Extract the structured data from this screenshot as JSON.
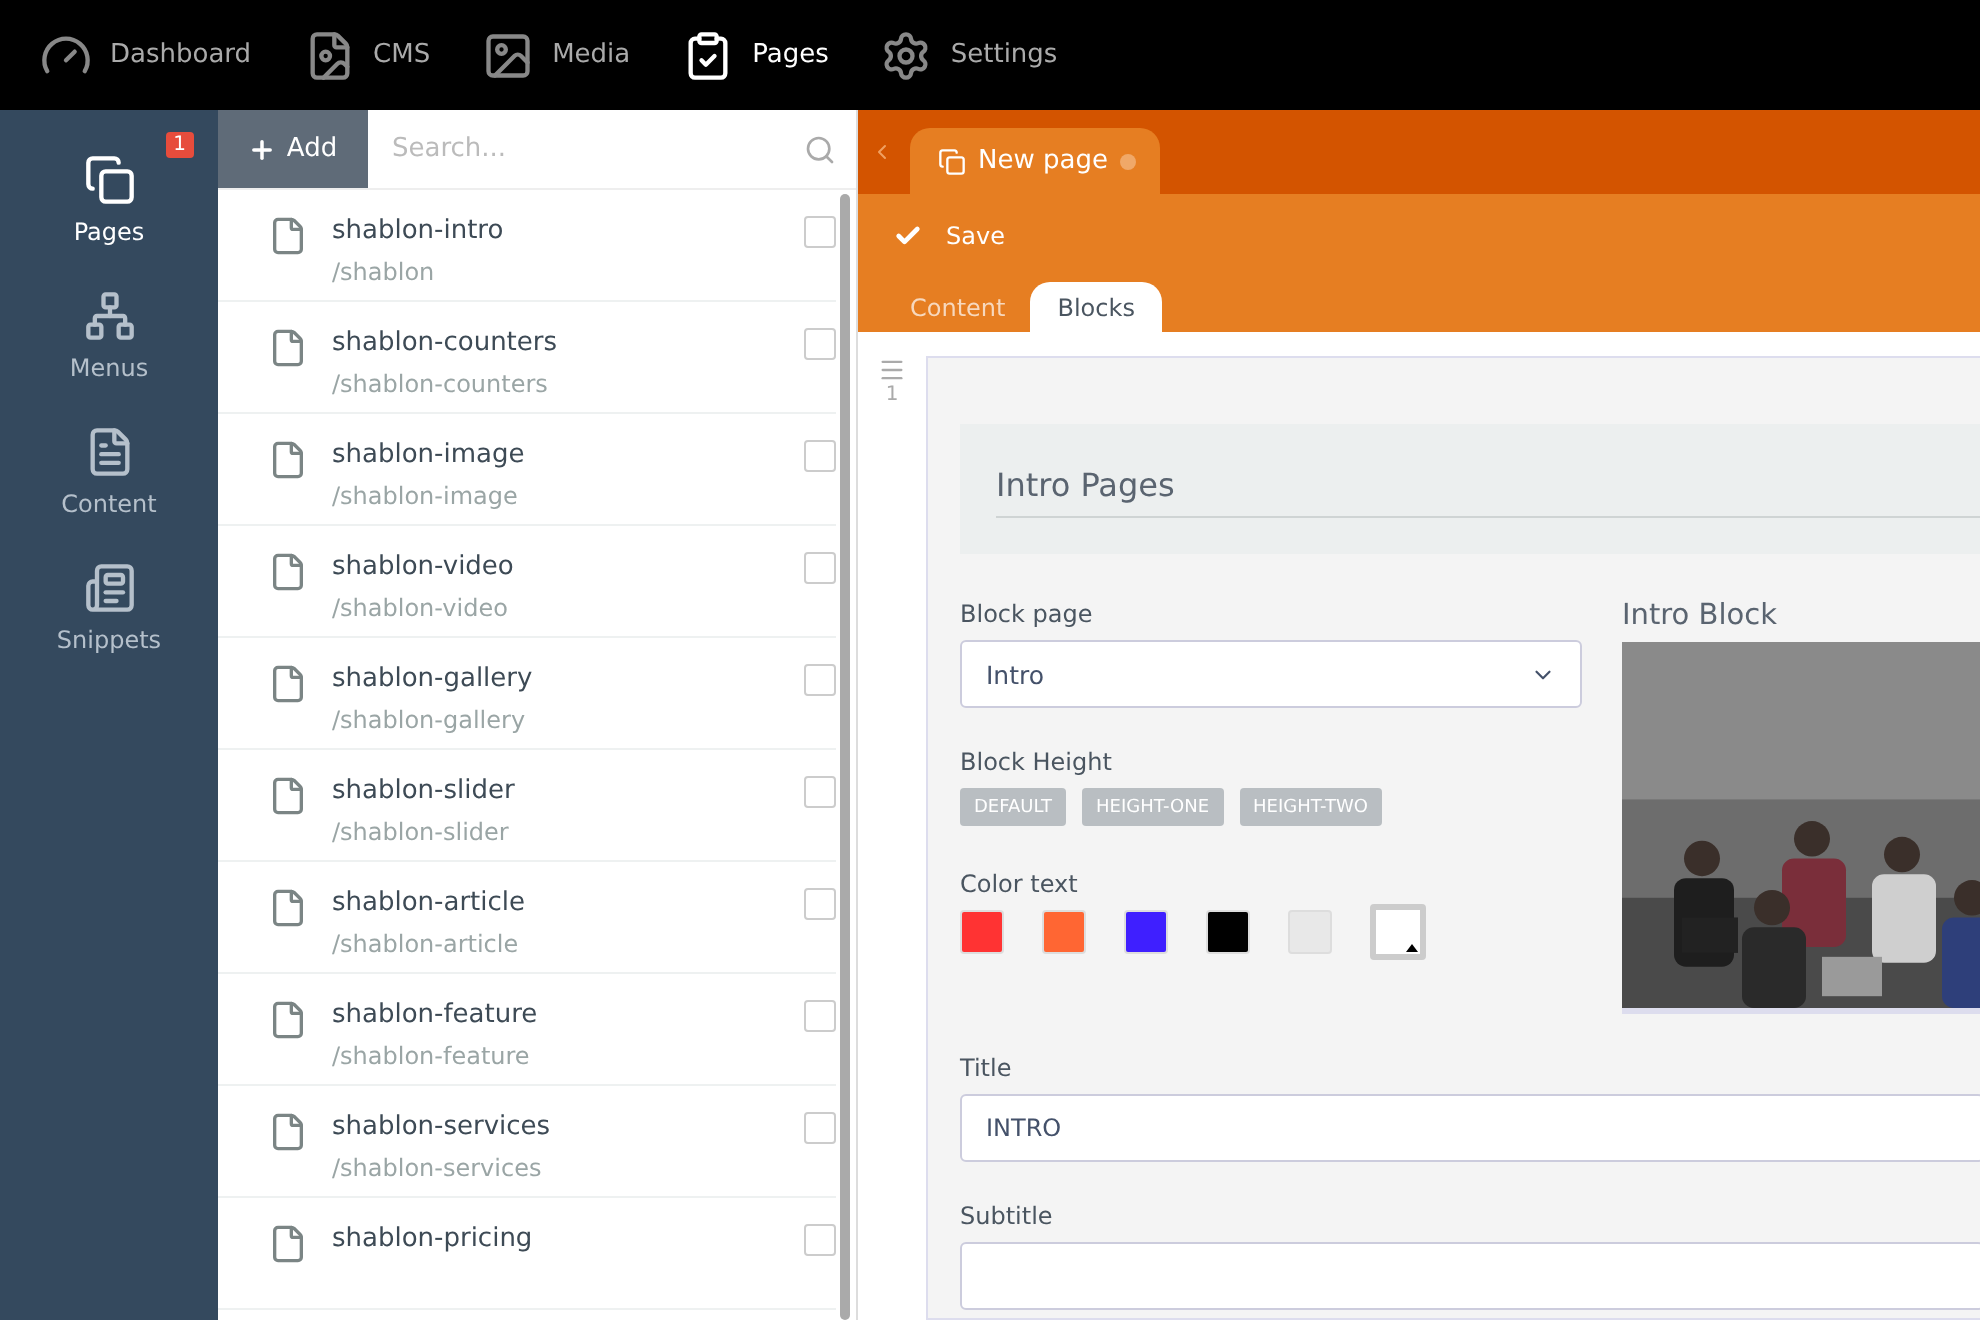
{
  "top_nav": [
    {
      "label": "Dashboard",
      "selected": false
    },
    {
      "label": "CMS",
      "selected": false
    },
    {
      "label": "Media",
      "selected": false
    },
    {
      "label": "Pages",
      "selected": true
    },
    {
      "label": "Settings",
      "selected": false
    }
  ],
  "sidebar": {
    "items": [
      {
        "label": "Pages",
        "selected": true,
        "badge": "1"
      },
      {
        "label": "Menus",
        "selected": false
      },
      {
        "label": "Content",
        "selected": false
      },
      {
        "label": "Snippets",
        "selected": false
      }
    ]
  },
  "page_list": {
    "add_button": "Add",
    "search": {
      "placeholder": "Search..."
    },
    "items": [
      {
        "name": "shablon-intro",
        "path": "/shablon",
        "checked": false
      },
      {
        "name": "shablon-counters",
        "path": "/shablon-counters",
        "checked": false
      },
      {
        "name": "shablon-image",
        "path": "/shablon-image",
        "checked": false
      },
      {
        "name": "shablon-video",
        "path": "/shablon-video",
        "checked": false
      },
      {
        "name": "shablon-gallery",
        "path": "/shablon-gallery",
        "checked": false
      },
      {
        "name": "shablon-slider",
        "path": "/shablon-slider",
        "checked": false
      },
      {
        "name": "shablon-article",
        "path": "/shablon-article",
        "checked": false
      },
      {
        "name": "shablon-feature",
        "path": "/shablon-feature",
        "checked": false
      },
      {
        "name": "shablon-services",
        "path": "/shablon-services",
        "checked": false
      },
      {
        "name": "shablon-pricing",
        "checked": false
      }
    ]
  },
  "editor": {
    "doc_tab": {
      "label": "New page",
      "unsaved": true
    },
    "save_button": "Save",
    "tabs": [
      {
        "label": "Content",
        "selected": false
      },
      {
        "label": "Blocks",
        "selected": true
      }
    ],
    "block_number": "1",
    "block": {
      "heading": "Intro Pages",
      "block_page": {
        "label": "Block page",
        "value": "Intro"
      },
      "block_height": {
        "label": "Block Height",
        "options": [
          "DEFAULT",
          "HEIGHT-ONE",
          "HEIGHT-TWO"
        ]
      },
      "color_text": {
        "label": "Color text",
        "swatches": [
          {
            "color": "#ff3333",
            "selected": false
          },
          {
            "color": "#ff6633",
            "selected": false
          },
          {
            "color": "#3f1fff",
            "selected": false
          },
          {
            "color": "#000000",
            "selected": false
          },
          {
            "color": "#e8e8e8",
            "selected": false
          },
          {
            "color": "#ffffff",
            "selected": true
          }
        ]
      },
      "preview": {
        "title": "Intro Block"
      },
      "title_field": {
        "label": "Title",
        "value": "INTRO"
      },
      "subtitle_field": {
        "label": "Subtitle"
      }
    }
  }
}
